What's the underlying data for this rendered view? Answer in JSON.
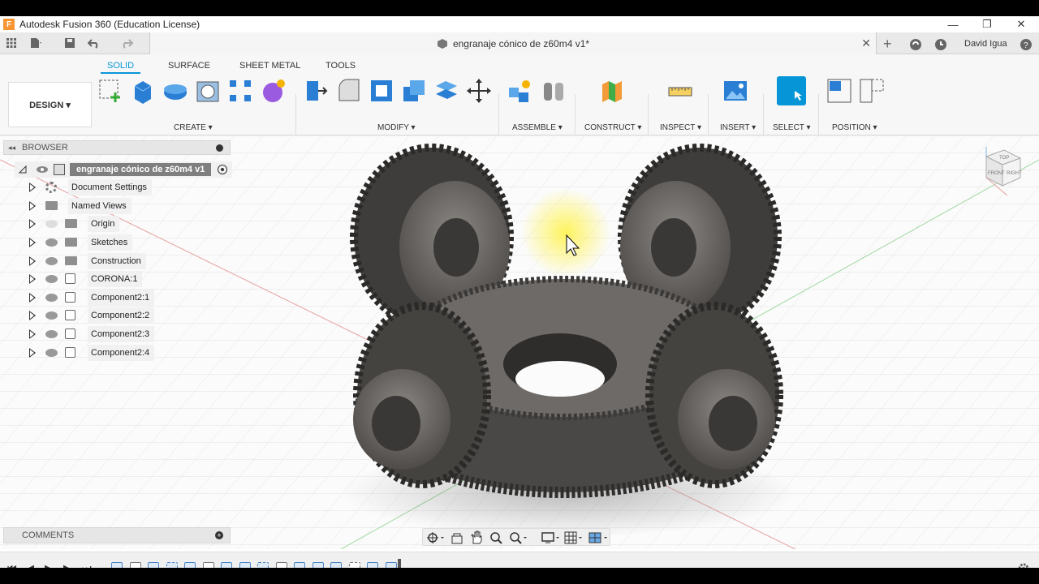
{
  "window": {
    "title": "Autodesk Fusion 360 (Education License)",
    "logo": "F",
    "controls": [
      "—",
      "❐",
      "✕"
    ]
  },
  "document_tab": {
    "title": "engranaje cónico de z60m4 v1*",
    "close": "✕"
  },
  "user": {
    "name": "David Igua"
  },
  "ribbon": {
    "tabs": [
      "SOLID",
      "SURFACE",
      "SHEET METAL",
      "TOOLS"
    ],
    "active_tab": "SOLID",
    "workspace": "DESIGN ▾",
    "groups": [
      "CREATE ▾",
      "MODIFY ▾",
      "ASSEMBLE ▾",
      "CONSTRUCT ▾",
      "INSPECT ▾",
      "INSERT ▾",
      "SELECT ▾",
      "POSITION ▾"
    ]
  },
  "browser": {
    "header": "BROWSER",
    "root": "engranaje cónico de z60m4 v1",
    "items": [
      {
        "label": "Document Settings",
        "icon": "gear-icon"
      },
      {
        "label": "Named Views",
        "icon": "folder-icon"
      },
      {
        "label": "Origin",
        "icon": "folder-icon"
      },
      {
        "label": "Sketches",
        "icon": "folder-icon"
      },
      {
        "label": "Construction",
        "icon": "folder-icon"
      },
      {
        "label": "CORONA:1",
        "icon": "component-icon"
      },
      {
        "label": "Component2:1",
        "icon": "component-icon"
      },
      {
        "label": "Component2:2",
        "icon": "component-icon"
      },
      {
        "label": "Component2:3",
        "icon": "component-icon"
      },
      {
        "label": "Component2:4",
        "icon": "component-icon"
      }
    ]
  },
  "comments": {
    "header": "COMMENTS"
  },
  "viewcube": {
    "faces": [
      "TOP",
      "FRONT",
      "RIGHT"
    ]
  },
  "colors": {
    "accent": "#0696d7",
    "gear": "#6b6866"
  }
}
